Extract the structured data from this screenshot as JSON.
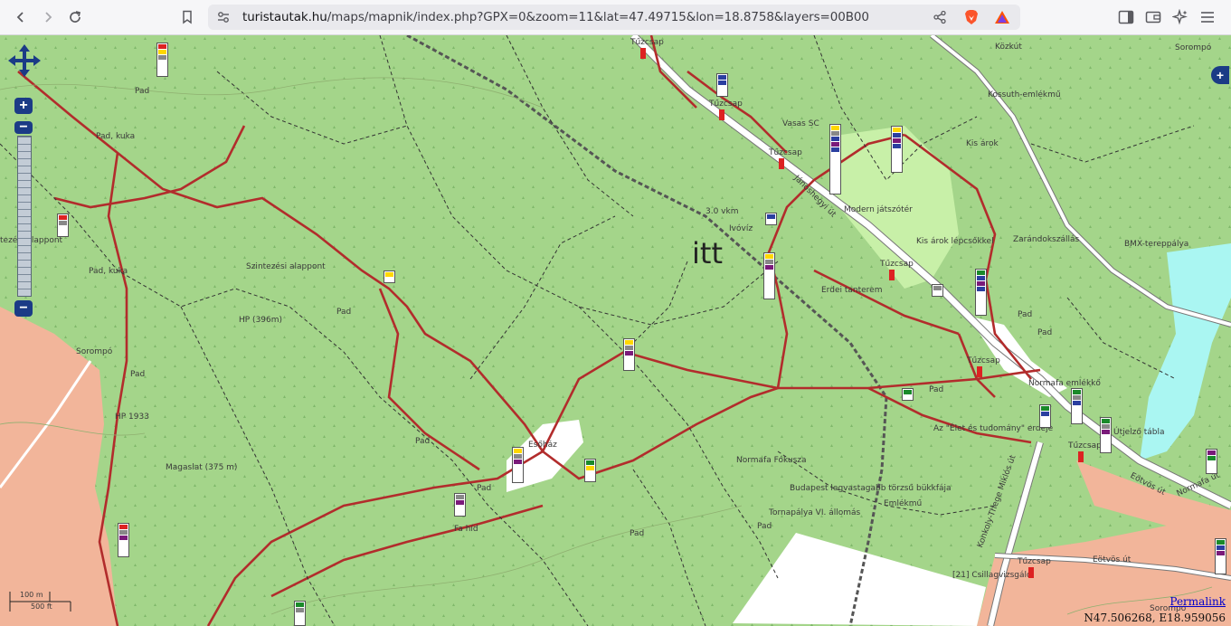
{
  "browser": {
    "url_host": "turistautak.hu",
    "url_path": "/maps/mapnik/index.php?GPX=0&zoom=11&lat=47.49715&lon=18.8758&layers=00B00"
  },
  "map": {
    "big_label": "itt",
    "labels": [
      "Tűzcsap",
      "Tűzcsap",
      "Tűzcsap",
      "Tűzcsap",
      "Tűzcsap",
      "Tűzcsap",
      "Tűzcsap",
      "Közkút",
      "Sorompó",
      "Kossuth-emlékmű",
      "Vasas SC",
      "Kis árok",
      "Pad",
      "Pad, kuka",
      "Pad, kuka",
      "Modern játszótér",
      "Zarándokszállás",
      "BMX-tereppálya",
      "3.0 vkm",
      "Ivóvíz",
      "Kis árok lépcsőkkel",
      "Szintezési alappont",
      "tezési alappont",
      "Erdei tanterem",
      "HP (396m)",
      "Pad",
      "Sorompó",
      "Pad",
      "Pad",
      "Pad",
      "HP 1933",
      "Pad",
      "Normafa emlékkő",
      "Az \"Élet és tudomány\" erdeje",
      "Útjelző tábla",
      "Esőház",
      "Magaslat (375 m)",
      "Pad",
      "Normafa Fókusza",
      "Budapest legvastagabb törzsű bükkfája",
      "Emlékmű",
      "Tornapálya VI. állomás",
      "Pad",
      "Fa híd",
      "Pad",
      "[21] Csillagvizsgáló",
      "Eötvös út",
      "Eötvös út",
      "Normafa út",
      "Konkoly-Thege Miklós út",
      "Jánoshegyi út",
      "Pad",
      "Sorompó"
    ],
    "scale_metric": "100 m",
    "scale_imperial": "500 ft",
    "permalink": "Permalink",
    "coordinates": "N47.506268, E18.959056"
  }
}
